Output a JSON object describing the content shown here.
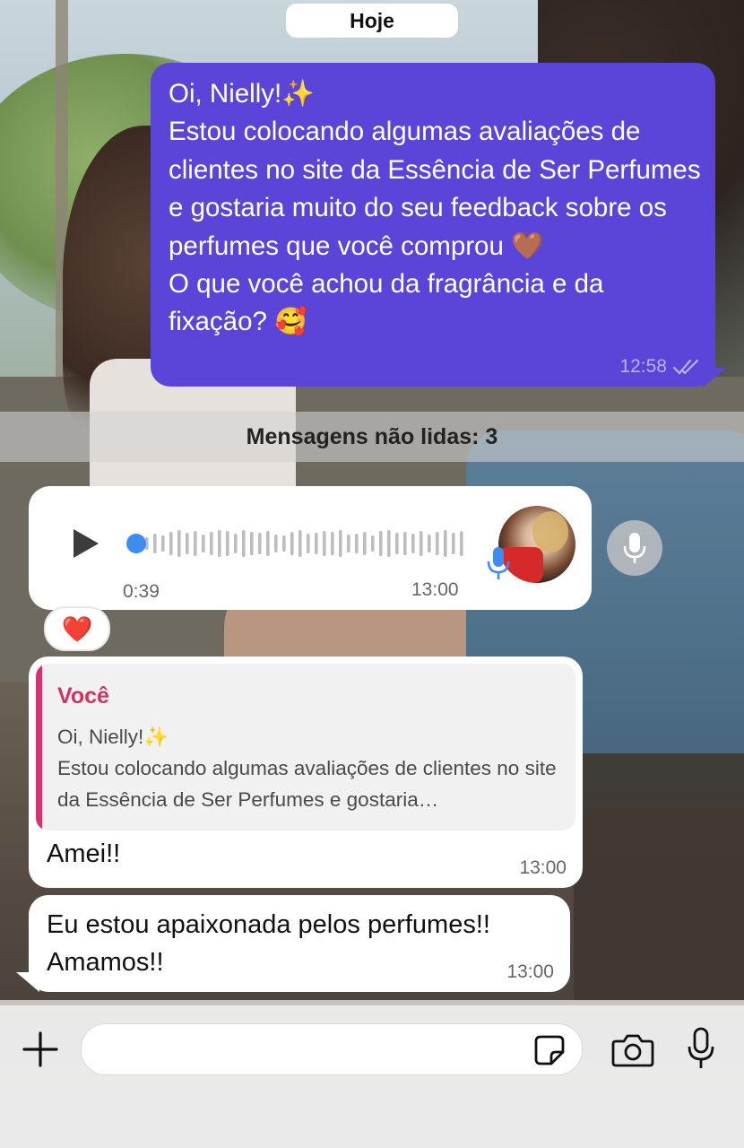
{
  "chat": {
    "date_chip": "Hoje",
    "outgoing_message": {
      "text": "Oi, Nielly!✨\nEstou colocando algumas avaliações de clientes no site da Essência de Ser Perfumes e gostaria muito do seu feedback sobre os perfumes que você comprou 🤎\nO que você achou da fragrância e da fixação? 🥰",
      "time": "12:58",
      "status_icon": "double-check-icon"
    },
    "unread_label": "Mensagens não lidas: 3",
    "voice_message": {
      "duration": "0:39",
      "time": "13:00",
      "progress": 0
    },
    "reaction": "❤️",
    "reply_message": {
      "quoted_author": "Você",
      "quoted_text": "Oi, Nielly!✨\nEstou colocando algumas avaliações de clientes no site da Essência de Ser Perfumes e gostaria…",
      "text": "Amei!!",
      "time": "13:00"
    },
    "incoming_message": {
      "text": "Eu estou apaixonada pelos perfumes!!\nAmamos!!",
      "time": "13:00"
    }
  },
  "composer": {
    "input_value": "",
    "input_placeholder": ""
  },
  "colors": {
    "outgoing_bubble": "#5a45d8",
    "incoming_bubble": "#ffffff",
    "quote_accent": "#d6336c",
    "voice_progress": "#3d8df0"
  }
}
